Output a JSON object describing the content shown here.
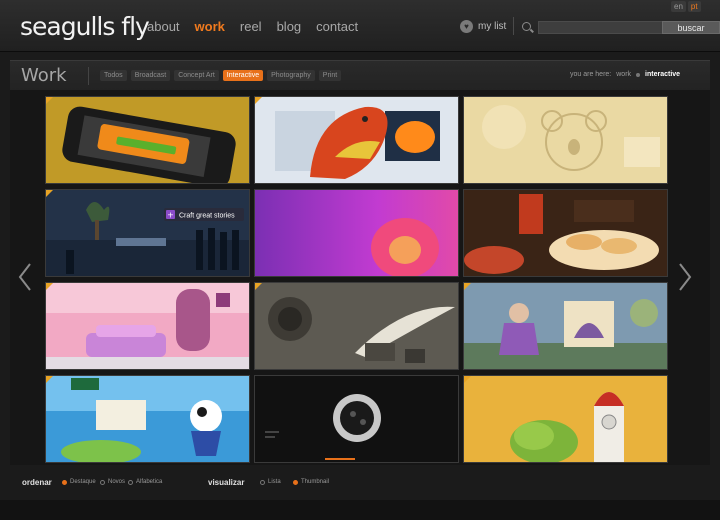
{
  "header": {
    "logo": "seagulls fly",
    "nav": [
      {
        "label": "about",
        "active": false
      },
      {
        "label": "work",
        "active": true
      },
      {
        "label": "reel",
        "active": false
      },
      {
        "label": "blog",
        "active": false
      },
      {
        "label": "contact",
        "active": false
      }
    ],
    "mylist_label": "my list",
    "languages": [
      "en",
      "pt"
    ],
    "selected_language": "pt",
    "search": {
      "value": "",
      "button_label": "buscar"
    }
  },
  "section": {
    "title": "Work",
    "filters": [
      {
        "label": "Todos",
        "active": false
      },
      {
        "label": "Broadcast",
        "active": false
      },
      {
        "label": "Concept Art",
        "active": false
      },
      {
        "label": "Interactive",
        "active": true
      },
      {
        "label": "Photography",
        "active": false
      },
      {
        "label": "Print",
        "active": false
      }
    ],
    "breadcrumb": {
      "prefix": "you are here:",
      "items": [
        "work",
        "interactive"
      ]
    }
  },
  "tiles": [
    {
      "subject": "smartphone app",
      "caption": ""
    },
    {
      "subject": "bubble pop plush dragon",
      "caption": ""
    },
    {
      "subject": "koala sketch",
      "caption": ""
    },
    {
      "subject": "3d office scene",
      "caption": "Craft great stories"
    },
    {
      "subject": "abstract purple",
      "caption": ""
    },
    {
      "subject": "food photography",
      "caption": ""
    },
    {
      "subject": "pink kids room",
      "caption": ""
    },
    {
      "subject": "feather still life",
      "caption": ""
    },
    {
      "subject": "fantasy girl illustration",
      "caption": ""
    },
    {
      "subject": "cartoon game",
      "caption": ""
    },
    {
      "subject": "speaker device",
      "caption": ""
    },
    {
      "subject": "rocket illustration",
      "caption": ""
    }
  ],
  "bottom": {
    "order_label": "ordenar",
    "order_options": [
      {
        "label": "Destaque",
        "selected": true
      },
      {
        "label": "Novos",
        "selected": false
      },
      {
        "label": "Alfabetica",
        "selected": false
      }
    ],
    "view_label": "visualizar",
    "view_options": [
      {
        "label": "Lista",
        "selected": false
      },
      {
        "label": "Thumbnail",
        "selected": true
      }
    ]
  },
  "colors": {
    "accent": "#e8711a",
    "corner_tag": "#e8a425"
  }
}
